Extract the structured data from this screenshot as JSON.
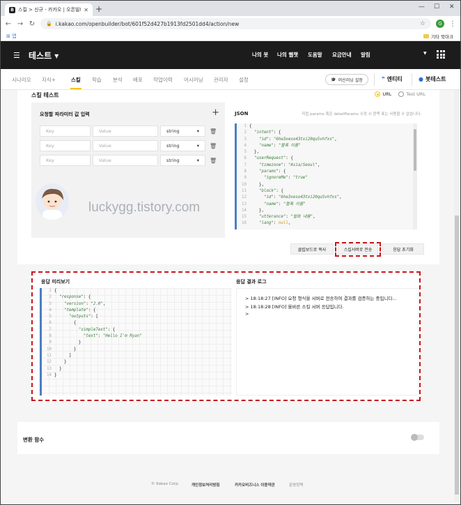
{
  "browser": {
    "tab_title": "스킬 > 신규 - 카카오 | 오픈빌더",
    "tab_favicon_letter": "B",
    "url": "i.kakao.com/openbuilder/bot/601f52d427b1913fd2501dd4/action/new",
    "profile_letter": "G",
    "bookmark_apps": "앱",
    "bookmark_other": "기타 북마크"
  },
  "app": {
    "brand": "테스트",
    "topnav": [
      "나의 봇",
      "나의 웹챗",
      "도움말",
      "요금안내",
      "알림"
    ]
  },
  "subnav": {
    "items": [
      "시나리오",
      "지식+",
      "스킬",
      "학습",
      "분석",
      "배포",
      "작업이력",
      "어시러닝",
      "관리자",
      "설정"
    ],
    "active": "스킬",
    "learn_button": "머신러닝 설정",
    "entity": "엔티티",
    "bottest": "봇테스트"
  },
  "skill_test": {
    "title": "스킬 테스트",
    "radio_url": "URL",
    "radio_test_url": "Test URL",
    "param_title": "요청할 파라미터 값 입력",
    "params": [
      {
        "key_placeholder": "Key",
        "value_placeholder": "Value",
        "type": "string"
      },
      {
        "key_placeholder": "Key",
        "value_placeholder": "Value",
        "type": "string"
      },
      {
        "key_placeholder": "Key",
        "value_placeholder": "Value",
        "type": "string"
      }
    ],
    "json_title": "JSON",
    "json_hint": "직접 params 혹은 detailParams 수정 시 왼쪽 표는 사용할 수 없습니다.",
    "json_lines": [
      "{",
      "  \"intent\": {",
      "    \"id\": \"6he3xeso43txi20qu5vhfxs\",",
      "    \"name\": \"블록 이름\"",
      "  },",
      "  \"userRequest\": {",
      "    \"timezone\": \"Asia/Seoul\",",
      "    \"params\": {",
      "      \"ignoreMe\": \"true\"",
      "    },",
      "    \"block\": {",
      "      \"id\": \"6he3xeso43txi20qu5vhfxs\",",
      "      \"name\": \"블록 이름\"",
      "    },",
      "    \"utterance\": \"발화 내용\",",
      "    \"lang\": null,"
    ],
    "watermark": "luckygg.tistory.com",
    "btn_copy": "클립보드로 복사",
    "btn_send": "스킬서버로 전송",
    "btn_reset": "응답 초기화"
  },
  "response": {
    "preview_title": "응답 미리보기",
    "log_title": "응답 결과 로그",
    "preview_lines": [
      "{",
      "  \"response\": {",
      "    \"version\": \"2.0\",",
      "    \"template\": {",
      "      \"outputs\": [",
      "        {",
      "          \"simpleText\": {",
      "            \"text\": \"Hello I'm Ryan\"",
      "          }",
      "        }",
      "      ]",
      "    }",
      "  }",
      "}"
    ],
    "log_lines": [
      "> 18:18:27 [INFO] 요청 형식을 서버로 전송하여 결과를 검증하는 중입니다...",
      "> 18:18:28 [INFO] 올바른 스킬 서버 응답입니다.",
      ">"
    ]
  },
  "converter": {
    "title": "변환 함수"
  },
  "footer": {
    "copyright": "© Kakao Corp.",
    "privacy": "개인정보처리방침",
    "terms": "카카오비즈니스 이용약관",
    "policy": "운영정책"
  }
}
